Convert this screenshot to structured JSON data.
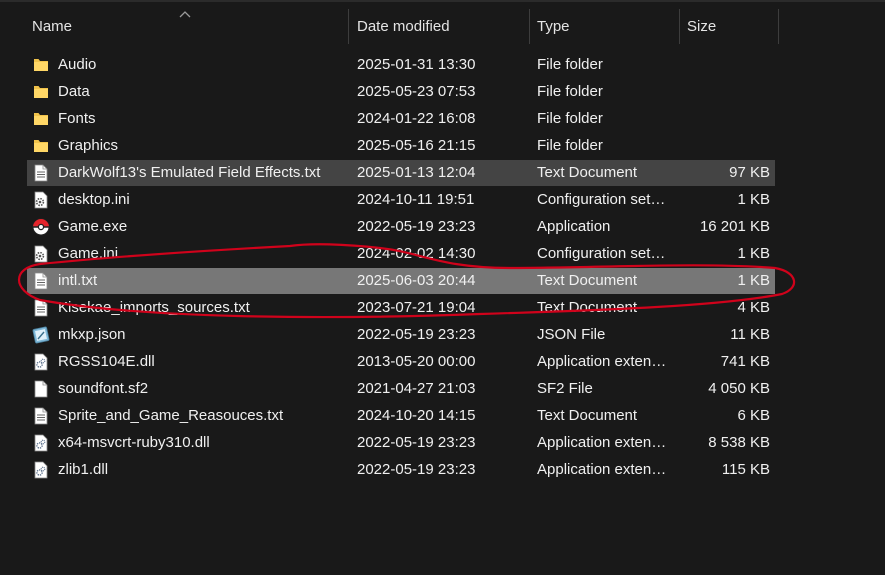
{
  "columns": {
    "name": "Name",
    "date": "Date modified",
    "type": "Type",
    "size": "Size"
  },
  "files": [
    {
      "name": "Audio",
      "date": "2025-01-31 13:30",
      "type": "File folder",
      "size": "",
      "icon": "folder-icon"
    },
    {
      "name": "Data",
      "date": "2025-05-23 07:53",
      "type": "File folder",
      "size": "",
      "icon": "folder-icon"
    },
    {
      "name": "Fonts",
      "date": "2024-01-22 16:08",
      "type": "File folder",
      "size": "",
      "icon": "folder-icon"
    },
    {
      "name": "Graphics",
      "date": "2025-05-16 21:15",
      "type": "File folder",
      "size": "",
      "icon": "folder-icon"
    },
    {
      "name": "DarkWolf13's Emulated Field Effects.txt",
      "date": "2025-01-13 12:04",
      "type": "Text Document",
      "size": "97 KB",
      "icon": "text-document-icon"
    },
    {
      "name": "desktop.ini",
      "date": "2024-10-11 19:51",
      "type": "Configuration setti...",
      "size": "1 KB",
      "icon": "settings-file-icon"
    },
    {
      "name": "Game.exe",
      "date": "2022-05-19 23:23",
      "type": "Application",
      "size": "16 201 KB",
      "icon": "pokeball-app-icon"
    },
    {
      "name": "Game.ini",
      "date": "2024-02-02 14:30",
      "type": "Configuration setti...",
      "size": "1 KB",
      "icon": "settings-file-icon"
    },
    {
      "name": "intl.txt",
      "date": "2025-06-03 20:44",
      "type": "Text Document",
      "size": "1 KB",
      "icon": "text-document-icon"
    },
    {
      "name": "Kisekae_imports_sources.txt",
      "date": "2023-07-21 19:04",
      "type": "Text Document",
      "size": "4 KB",
      "icon": "text-document-icon"
    },
    {
      "name": "mkxp.json",
      "date": "2022-05-19 23:23",
      "type": "JSON File",
      "size": "11 KB",
      "icon": "json-file-icon"
    },
    {
      "name": "RGSS104E.dll",
      "date": "2013-05-20 00:00",
      "type": "Application extens...",
      "size": "741 KB",
      "icon": "dll-file-icon"
    },
    {
      "name": "soundfont.sf2",
      "date": "2021-04-27 21:03",
      "type": "SF2 File",
      "size": "4 050 KB",
      "icon": "blank-file-icon"
    },
    {
      "name": "Sprite_and_Game_Reasouces.txt",
      "date": "2024-10-20 14:15",
      "type": "Text Document",
      "size": "6 KB",
      "icon": "text-document-icon"
    },
    {
      "name": "x64-msvcrt-ruby310.dll",
      "date": "2022-05-19 23:23",
      "type": "Application extens...",
      "size": "8 538 KB",
      "icon": "dll-file-icon"
    },
    {
      "name": "zlib1.dll",
      "date": "2022-05-19 23:23",
      "type": "Application extens...",
      "size": "115 KB",
      "icon": "dll-file-icon"
    }
  ],
  "selection": {
    "selected": [
      "DarkWolf13's Emulated Field Effects.txt",
      "intl.txt"
    ],
    "focused": "intl.txt"
  },
  "colors": {
    "background": "#191919",
    "folder": "#f0c24a",
    "selected_row": "#444444",
    "focused_row": "#777777",
    "annotation": "#d0021b"
  }
}
